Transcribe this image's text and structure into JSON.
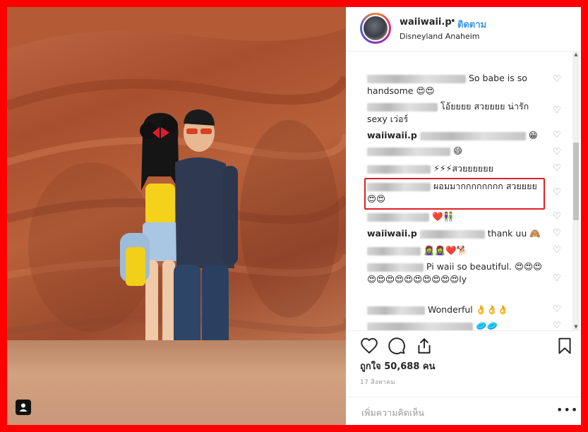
{
  "post": {
    "username": "waiiwaii.p",
    "separator": "•",
    "follow_label": "ติดตาม",
    "location": "Disneyland Anaheim"
  },
  "comments": [
    {
      "text": "So babe is so handsome 😍😍"
    },
    {
      "text": "โอ้ยยยย สวยยยย น่ารัก sexy เว่อร์"
    },
    {
      "user": "waiiwaii.p",
      "text": "😁"
    },
    {
      "text": "😄"
    },
    {
      "text": "⚡⚡⚡สวยยยยยย"
    },
    {
      "text": "ผอมมากกกกกกกก สวยยยย😍😍"
    },
    {
      "text": "❤️👫"
    },
    {
      "user": "waiiwaii.p",
      "text": "thank uu 🙈"
    },
    {
      "text": "🧟‍♀️🧟‍♀️❤️🐕"
    },
    {
      "text": "Pi waii so beautiful. 😍😍😍😍😍😍😍😍😍😍😍😍😍ly"
    },
    {
      "text": "Wonderful 👌👌👌"
    },
    {
      "text": "🥏🥏"
    }
  ],
  "icons": {
    "like": "heart-icon",
    "comment": "comment-icon",
    "share": "share-icon",
    "save": "bookmark-icon",
    "more": "more-options-icon",
    "tag": "user-tag-icon"
  },
  "stats": {
    "likes": "ถูกใจ 50,688 คน",
    "date": "17 สิงหาคม"
  },
  "add_comment": {
    "placeholder": "เพิ่มความคิดเห็น",
    "more_label": "•••"
  },
  "colors": {
    "link": "#3897f0",
    "highlight": "#e02020",
    "border": "#ff0000"
  }
}
